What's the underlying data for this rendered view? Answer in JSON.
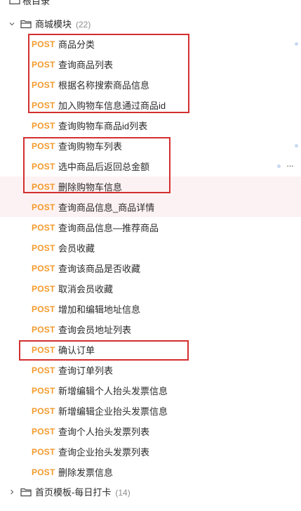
{
  "root": {
    "label": "根目录"
  },
  "folders": [
    {
      "label": "商城模块",
      "count": "(22)",
      "expanded": true
    },
    {
      "label": "首页模板-每日打卡",
      "count": "(14)",
      "expanded": false
    }
  ],
  "apis": [
    {
      "method": "POST",
      "name": "商品分类"
    },
    {
      "method": "POST",
      "name": "查询商品列表"
    },
    {
      "method": "POST",
      "name": "根据名称搜索商品信息"
    },
    {
      "method": "POST",
      "name": "加入购物车信息通过商品id"
    },
    {
      "method": "POST",
      "name": "查询购物车商品id列表"
    },
    {
      "method": "POST",
      "name": "查询购物车列表"
    },
    {
      "method": "POST",
      "name": "选中商品后返回总金额"
    },
    {
      "method": "POST",
      "name": "删除购物车信息"
    },
    {
      "method": "POST",
      "name": "查询商品信息_商品详情"
    },
    {
      "method": "POST",
      "name": "查询商品信息—推荐商品"
    },
    {
      "method": "POST",
      "name": "会员收藏"
    },
    {
      "method": "POST",
      "name": "查询该商品是否收藏"
    },
    {
      "method": "POST",
      "name": "取消会员收藏"
    },
    {
      "method": "POST",
      "name": "增加和编辑地址信息"
    },
    {
      "method": "POST",
      "name": "查询会员地址列表"
    },
    {
      "method": "POST",
      "name": "确认订单"
    },
    {
      "method": "POST",
      "name": "查询订单列表"
    },
    {
      "method": "POST",
      "name": "新增编辑个人抬头发票信息"
    },
    {
      "method": "POST",
      "name": "新增编辑企业抬头发票信息"
    },
    {
      "method": "POST",
      "name": "查询个人抬头发票列表"
    },
    {
      "method": "POST",
      "name": "查询企业抬头发票列表"
    },
    {
      "method": "POST",
      "name": "删除发票信息"
    }
  ],
  "more_menu": {
    "label": "···"
  },
  "colors": {
    "method_post": "#f39a2c",
    "annotation_box": "#d32f2f",
    "row_highlight": "#fdf2f3"
  }
}
